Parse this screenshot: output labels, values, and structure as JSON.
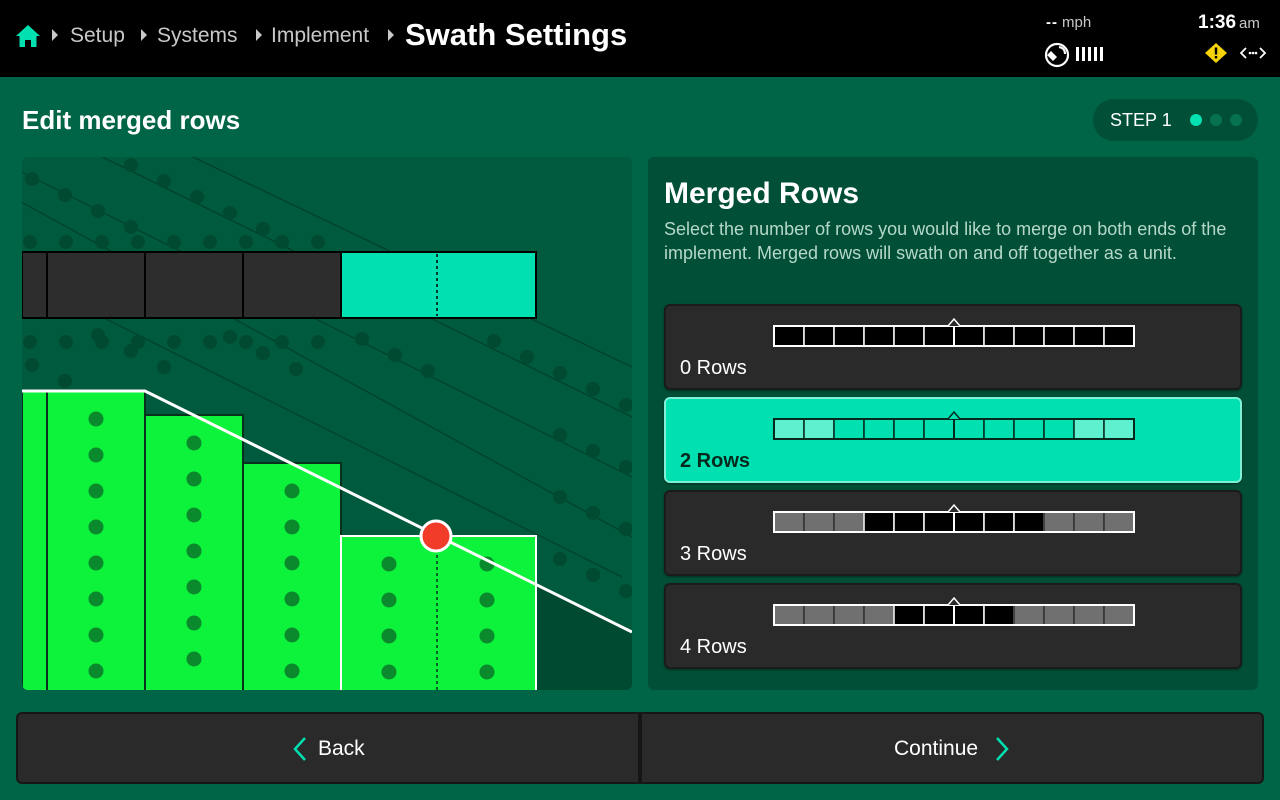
{
  "topbar": {
    "breadcrumbs": [
      "Setup",
      "Systems",
      "Implement"
    ],
    "title": "Swath Settings",
    "speed_value": "--",
    "speed_unit": "mph",
    "time": "1:36",
    "ampm": "am",
    "icons": [
      "home-icon",
      "gps-icon",
      "signal-bars-icon",
      "warning-icon",
      "link-arrows-icon"
    ]
  },
  "section": {
    "title": "Edit merged rows",
    "step_label": "STEP 1",
    "step_total": 3,
    "step_current": 1
  },
  "panel": {
    "title": "Merged Rows",
    "description": "Select the number of rows you would like to merge on both ends of the implement. Merged rows will swath on and off together as a unit.",
    "options": [
      {
        "label": "0 Rows",
        "merged": 0,
        "selected": false
      },
      {
        "label": "2 Rows",
        "merged": 2,
        "selected": true
      },
      {
        "label": "3 Rows",
        "merged": 3,
        "selected": false
      },
      {
        "label": "4 Rows",
        "merged": 4,
        "selected": false
      }
    ]
  },
  "buttons": {
    "back": "Back",
    "continue": "Continue"
  },
  "colors": {
    "background": "#006446",
    "accent": "#00e0b0",
    "covered": "#0df23a",
    "marker": "#f23c2a"
  }
}
